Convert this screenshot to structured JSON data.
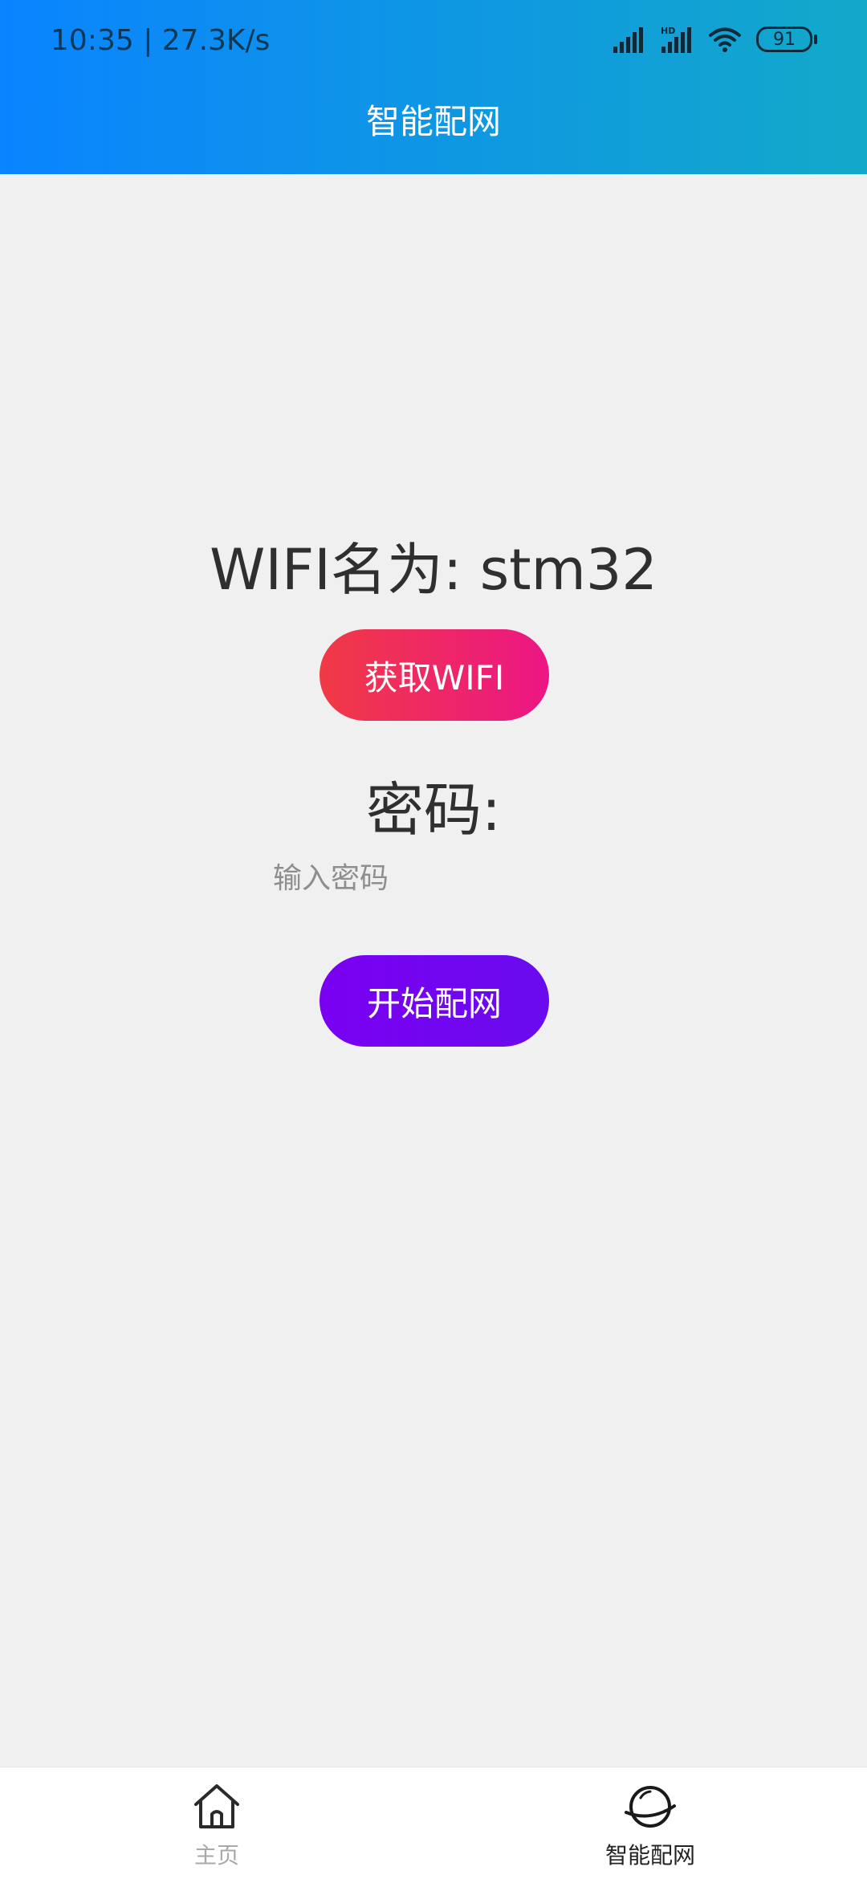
{
  "status_bar": {
    "time_speed": "10:35 | 27.3K/s",
    "battery": "91",
    "hd_label": "HD"
  },
  "header": {
    "title": "智能配网"
  },
  "main": {
    "wifi_name_text": "WIFI名为: stm32",
    "get_wifi_button": "获取WIFI",
    "password_label": "密码:",
    "password_placeholder": "输入密码",
    "password_value": "",
    "start_button": "开始配网"
  },
  "bottom_nav": {
    "items": [
      {
        "label": "主页",
        "icon": "home-icon",
        "active": false
      },
      {
        "label": "智能配网",
        "icon": "planet-icon",
        "active": true
      }
    ]
  },
  "colors": {
    "header_gradient_start": "#0a84ff",
    "header_gradient_end": "#13a9c9",
    "get_wifi_gradient_start": "#f03a45",
    "get_wifi_gradient_end": "#ec1685",
    "start_button_color": "#7a00f2",
    "background": "#f0f0f0"
  }
}
